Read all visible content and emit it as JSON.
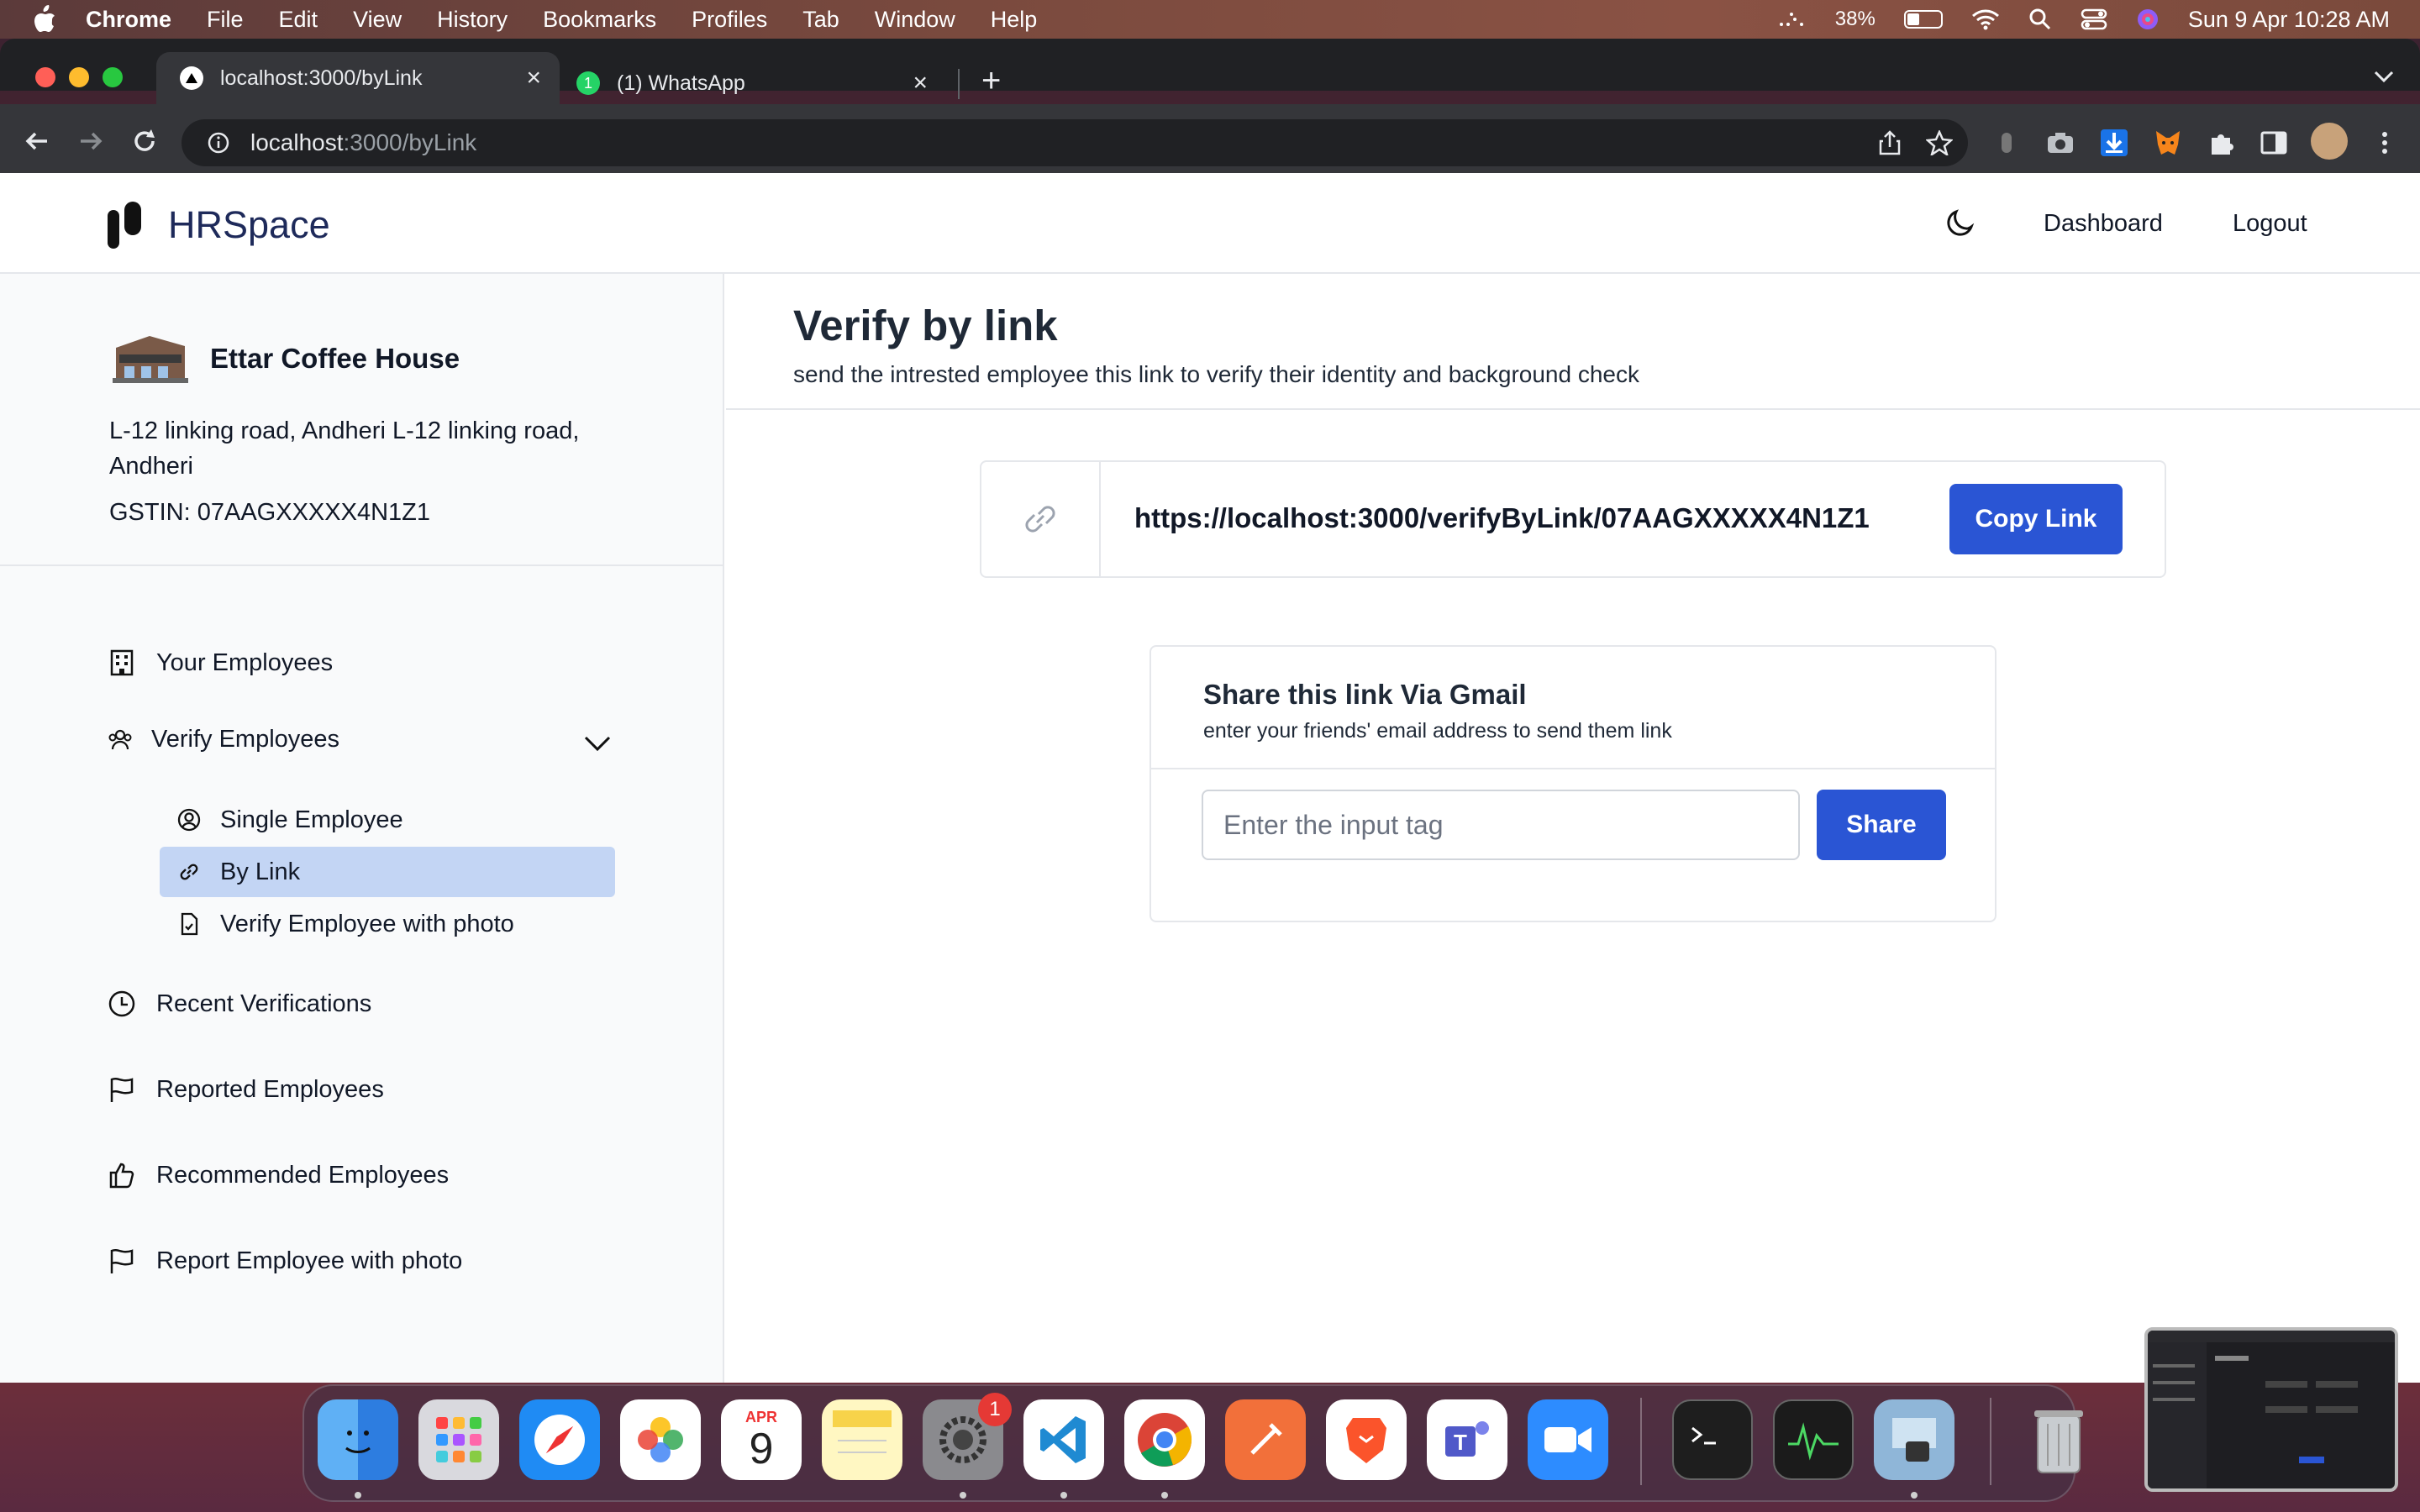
{
  "menubar": {
    "app": "Chrome",
    "items": [
      "File",
      "Edit",
      "View",
      "History",
      "Bookmarks",
      "Profiles",
      "Tab",
      "Window",
      "Help"
    ],
    "battery": "38%",
    "datetime": "Sun 9 Apr  10:28 AM"
  },
  "browser": {
    "tabs": [
      {
        "title": "localhost:3000/byLink"
      },
      {
        "title": "(1) WhatsApp",
        "badge": "1"
      }
    ],
    "url_host": "localhost",
    "url_path": ":3000/byLink"
  },
  "header": {
    "brand": "HRSpace",
    "nav": {
      "dashboard": "Dashboard",
      "logout": "Logout"
    }
  },
  "business": {
    "name": "Ettar Coffee House",
    "address": "L-12 linking road, Andheri L-12 linking road, Andheri",
    "gstin": "GSTIN: 07AAGXXXXX4N1Z1"
  },
  "sidebar": {
    "items": [
      {
        "label": "Your Employees"
      },
      {
        "label": "Verify Employees"
      },
      {
        "label": "Recent Verifications"
      },
      {
        "label": "Reported Employees"
      },
      {
        "label": "Recommended Employees"
      },
      {
        "label": "Report Employee with photo"
      }
    ],
    "sub_items": [
      {
        "label": "Single Employee"
      },
      {
        "label": "By Link"
      },
      {
        "label": "Verify Employee with photo"
      }
    ]
  },
  "main": {
    "title": "Verify by link",
    "subtitle": "send the intrested employee this link to verify their identity and background check",
    "link": "https://localhost:3000/verifyByLink/07AAGXXXXX4N1Z1",
    "copy_label": "Copy Link",
    "share": {
      "title": "Share this link Via Gmail",
      "subtitle": "enter your friends' email address to send them link",
      "placeholder": "Enter the input tag",
      "button": "Share"
    }
  },
  "dock": {
    "calendar_month": "APR",
    "calendar_day": "9",
    "settings_badge": "1"
  },
  "colors": {
    "primary": "#2a55d4",
    "active_item": "#c3d5f4",
    "brand": "#1e2a5a"
  }
}
